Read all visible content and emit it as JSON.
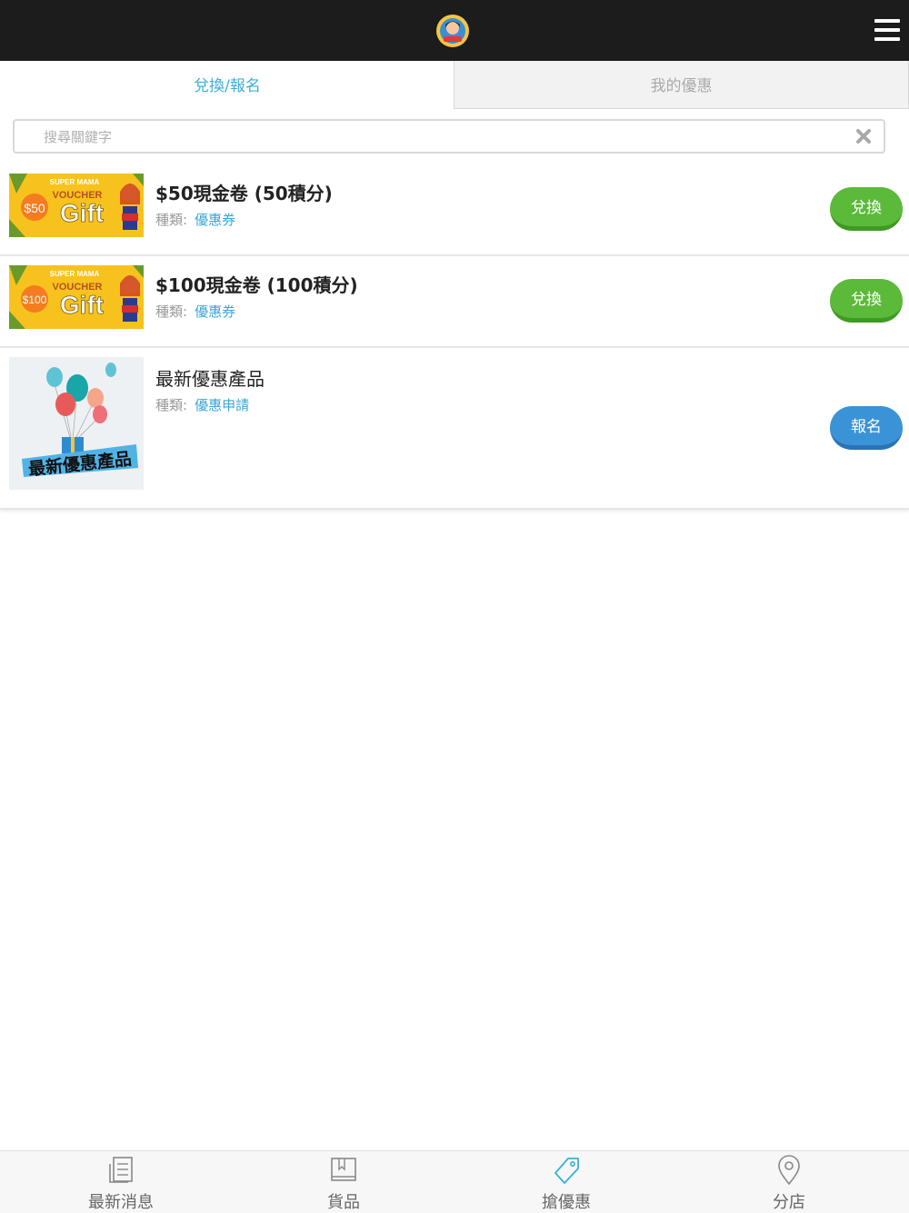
{
  "tabs": {
    "exchange": "兌換/報名",
    "my_offers": "我的優惠"
  },
  "search": {
    "placeholder": "搜尋關鍵字"
  },
  "items": [
    {
      "title": "$50現金卷 (50積分)",
      "type_label": "種類:",
      "type_value": "優惠券",
      "action": "兌換",
      "thumb": {
        "brand": "SUPER MAMA",
        "voucher": "VOUCHER",
        "gift": "Gift",
        "amount": "$50"
      }
    },
    {
      "title": "$100現金卷 (100積分)",
      "type_label": "種類:",
      "type_value": "優惠券",
      "action": "兌換",
      "thumb": {
        "brand": "SUPER MAMA",
        "voucher": "VOUCHER",
        "gift": "Gift",
        "amount": "$100"
      }
    },
    {
      "title": "最新優惠產品",
      "type_label": "種類:",
      "type_value": "優惠申請",
      "action": "報名",
      "thumb": {
        "caption": "最新優惠產品"
      }
    }
  ],
  "nav": [
    {
      "label": "最新消息",
      "icon": "news-icon"
    },
    {
      "label": "貨品",
      "icon": "book-icon"
    },
    {
      "label": "搶優惠",
      "icon": "tag-icon"
    },
    {
      "label": "分店",
      "icon": "location-pin-icon"
    }
  ],
  "colors": {
    "topbar": "#1c1c1c",
    "accent": "#3bb0d7",
    "green_button": "#5cba3a",
    "blue_button": "#3a93d6"
  }
}
